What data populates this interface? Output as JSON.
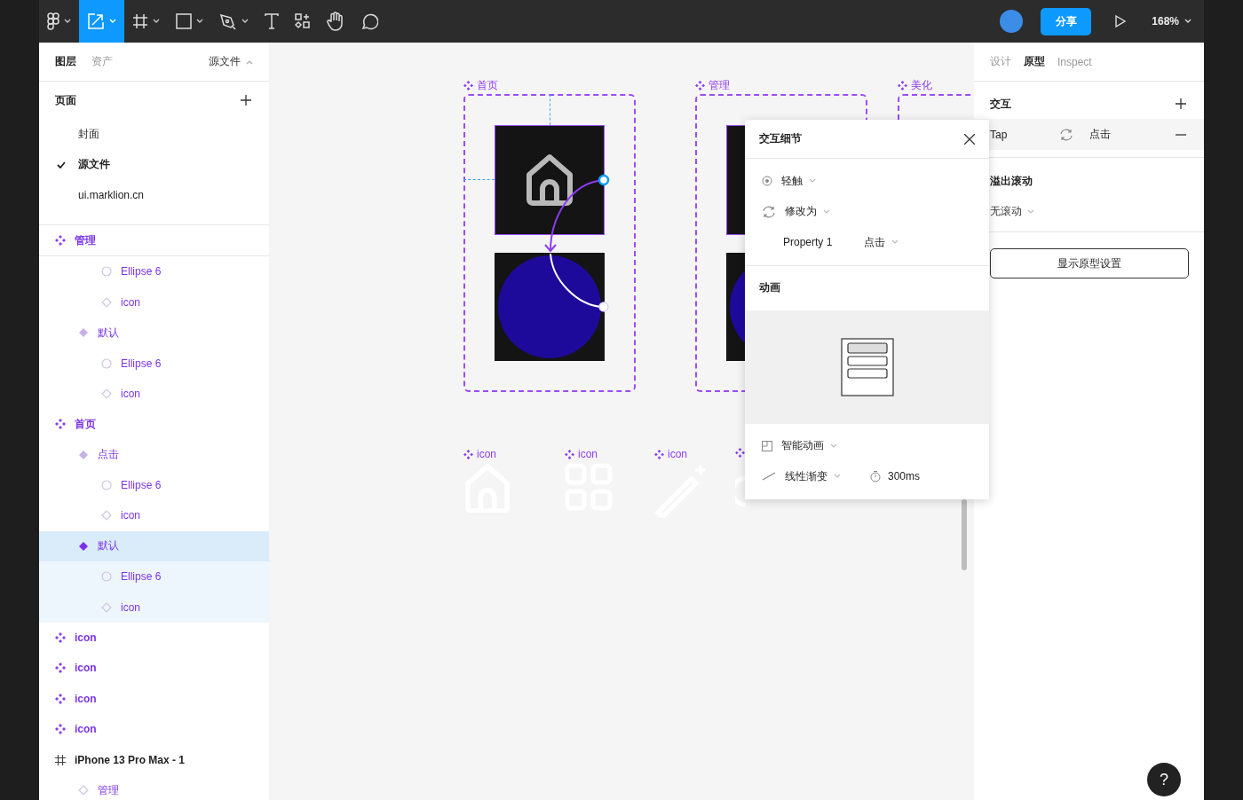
{
  "toolbar": {
    "tools": [
      {
        "kind": "main-menu",
        "selected": false,
        "menu": true
      },
      {
        "kind": "move",
        "selected": true,
        "menu": true
      },
      {
        "kind": "frame",
        "selected": false,
        "menu": true
      },
      {
        "kind": "rectangle",
        "selected": false,
        "menu": true
      },
      {
        "kind": "pen",
        "selected": false,
        "menu": true
      },
      {
        "kind": "text",
        "selected": false,
        "menu": false
      },
      {
        "kind": "components",
        "selected": false,
        "menu": false
      },
      {
        "kind": "hand",
        "selected": false,
        "menu": false
      },
      {
        "kind": "comment",
        "selected": false,
        "menu": false
      }
    ],
    "share": "分享",
    "zoom": "168%"
  },
  "left_panel": {
    "tabs": [
      {
        "label": "图层",
        "selected": true
      },
      {
        "label": "资产",
        "selected": false
      }
    ],
    "page_switch": "源文件",
    "pages_title": "页面",
    "pages": [
      {
        "label": "封面",
        "selected": false
      },
      {
        "label": "源文件",
        "selected": true
      },
      {
        "label": "ui.marklion.cn",
        "selected": false
      }
    ],
    "layers": [
      {
        "kind": "component",
        "label": "管理",
        "selected": false,
        "children": [
          {
            "children": [
              {
                "kind": "ellipse",
                "label": "Ellipse 6",
                "selected": false
              },
              {
                "kind": "instance",
                "label": "icon",
                "selected": false
              }
            ]
          },
          {
            "kind": "variant",
            "label": "默认",
            "selected": false,
            "children": [
              {
                "kind": "ellipse",
                "label": "Ellipse 6",
                "selected": false
              },
              {
                "kind": "instance",
                "label": "icon",
                "selected": false
              }
            ]
          }
        ]
      },
      {
        "kind": "component",
        "label": "首页",
        "selected": false,
        "children": [
          {
            "kind": "variant",
            "label": "点击",
            "selected": false,
            "children": [
              {
                "kind": "ellipse",
                "label": "Ellipse 6",
                "selected": false
              },
              {
                "kind": "instance",
                "label": "icon",
                "selected": false
              }
            ]
          },
          {
            "kind": "variant",
            "label": "默认",
            "selected": true,
            "children": [
              {
                "kind": "ellipse",
                "label": "Ellipse 6",
                "selected": false
              },
              {
                "kind": "instance",
                "label": "icon",
                "selected": false
              }
            ]
          }
        ]
      },
      {
        "kind": "component",
        "label": "icon",
        "selected": false
      },
      {
        "kind": "component",
        "label": "icon",
        "selected": false
      },
      {
        "kind": "component",
        "label": "icon",
        "selected": false
      },
      {
        "kind": "component",
        "label": "icon",
        "selected": false
      },
      {
        "kind": "frame",
        "label": "iPhone 13 Pro Max - 1",
        "selected": false,
        "children": [
          {
            "kind": "instance",
            "label": "管理",
            "selected": false
          }
        ]
      }
    ]
  },
  "canvas": {
    "frames": [
      {
        "label": "首页",
        "selected": true
      },
      {
        "label": "管理"
      },
      {
        "label": "美化"
      }
    ],
    "icon_components": [
      {
        "label": "icon",
        "kind": "home"
      },
      {
        "label": "icon",
        "kind": "grid"
      },
      {
        "label": "icon",
        "kind": "wand"
      },
      {
        "kind": "gear"
      }
    ]
  },
  "interaction_popup": {
    "title": "交互细节",
    "trigger": "轻触",
    "action": "修改为",
    "property": "Property 1",
    "property_value": "点击",
    "animation_title": "动画",
    "animation": "智能动画",
    "easing": "线性渐变",
    "duration": "300ms"
  },
  "right_panel": {
    "tabs": [
      {
        "label": "设计",
        "selected": false
      },
      {
        "label": "原型",
        "selected": true
      },
      {
        "label": "Inspect",
        "selected": false
      }
    ],
    "interactions_title": "交互",
    "interactions": [
      {
        "trigger": "Tap",
        "action": "点击"
      }
    ],
    "overflow_title": "溢出滚动",
    "overflow_value": "无滚动",
    "settings_button": "显示原型设置"
  },
  "help": "?"
}
